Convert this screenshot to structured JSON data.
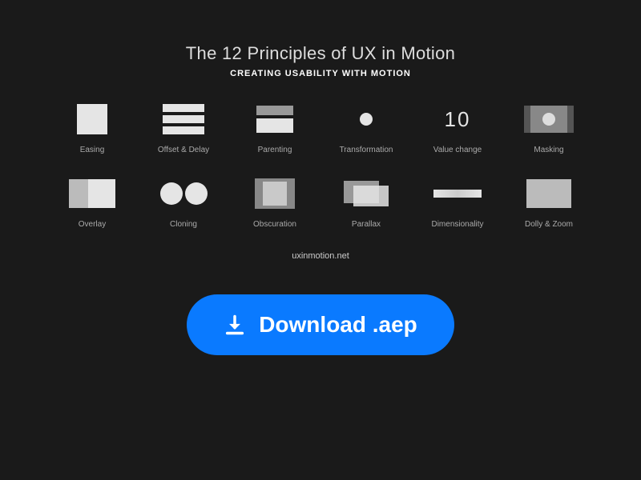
{
  "header": {
    "title": "The 12 Principles of UX in Motion",
    "subtitle": "CREATING USABILITY WITH MOTION"
  },
  "principles": [
    {
      "name": "Easing"
    },
    {
      "name": "Offset & Delay"
    },
    {
      "name": "Parenting"
    },
    {
      "name": "Transformation"
    },
    {
      "name": "Value change"
    },
    {
      "name": "Masking"
    },
    {
      "name": "Overlay"
    },
    {
      "name": "Cloning"
    },
    {
      "name": "Obscuration"
    },
    {
      "name": "Parallax"
    },
    {
      "name": "Dimensionality"
    },
    {
      "name": "Dolly & Zoom"
    }
  ],
  "footer": {
    "url": "uxinmotion.net"
  },
  "cta": {
    "label": "Download .aep"
  }
}
